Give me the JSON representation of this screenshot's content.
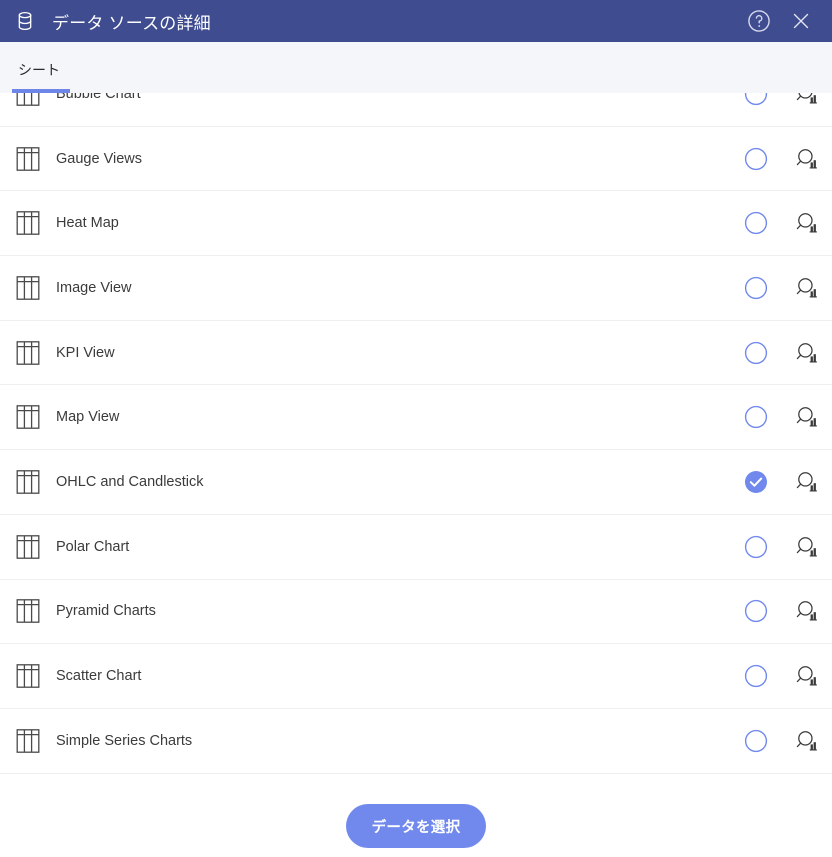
{
  "window": {
    "title": "データ ソースの詳細",
    "db_icon": "database-icon",
    "help_icon": "help-circle-icon",
    "close_icon": "close-icon"
  },
  "tabs": [
    {
      "label": "シート",
      "active": true
    }
  ],
  "list": {
    "row_icon": "table-grid-icon",
    "radio_unselected_icon": "radio-unchecked-icon",
    "radio_selected_icon": "radio-checked-icon",
    "preview_icon": "data-preview-magnifier-chart-icon",
    "items": [
      {
        "label": "Bubble Chart",
        "selected": false
      },
      {
        "label": "Gauge Views",
        "selected": false
      },
      {
        "label": "Heat Map",
        "selected": false
      },
      {
        "label": "Image View",
        "selected": false
      },
      {
        "label": "KPI View",
        "selected": false
      },
      {
        "label": "Map View",
        "selected": false
      },
      {
        "label": "OHLC and Candlestick",
        "selected": true
      },
      {
        "label": "Polar Chart",
        "selected": false
      },
      {
        "label": "Pyramid Charts",
        "selected": false
      },
      {
        "label": "Scatter Chart",
        "selected": false
      },
      {
        "label": "Simple Series Charts",
        "selected": false
      }
    ]
  },
  "footer": {
    "select_button_label": "データを選択"
  },
  "colors": {
    "header_bg": "#3F4C90",
    "accent": "#7189EC",
    "tab_bg": "#F4F6FA",
    "row_divider": "#EFEFEF",
    "text": "#3b3b3b"
  }
}
